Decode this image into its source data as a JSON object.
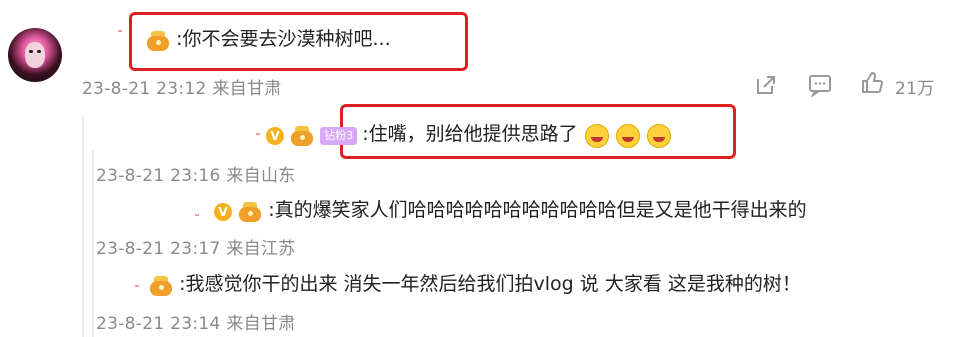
{
  "comment": {
    "text": ":你不会要去沙漠种树吧...",
    "meta": "23-8-21 23:12 来自甘肃",
    "likes": "21万"
  },
  "replies": [
    {
      "text": ":住嘴，别给他提供思路了",
      "meta": "23-8-21 23:16 来自山东",
      "badge_label": "钻粉3"
    },
    {
      "text": ":真的爆笑家人们哈哈哈哈哈哈哈哈哈哈哈但是又是他干得出来的",
      "meta": "23-8-21 23:17 来自江苏"
    },
    {
      "text": ":我感觉你干的出来 消失一年然后给我们拍vlog 说 大家看 这是我种的树！",
      "meta": "23-8-21 23:14 来自甘肃"
    }
  ],
  "icons": {
    "share": "share-icon",
    "comment": "comment-icon",
    "like": "thumbs-up-icon",
    "verified": "verified-v-icon",
    "crown": "crown-icon",
    "emoji": "laughing-crying-emoji"
  },
  "colors": {
    "highlight": "#e02020",
    "meta_text": "#8a8a8a",
    "body_text": "#222222"
  }
}
